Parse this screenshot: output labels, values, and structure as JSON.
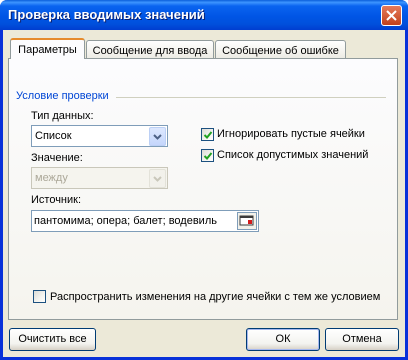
{
  "window": {
    "title": "Проверка вводимых значений"
  },
  "tabs": [
    {
      "label": "Параметры"
    },
    {
      "label": "Сообщение для ввода"
    },
    {
      "label": "Сообщение об ошибке"
    }
  ],
  "validation": {
    "group_label": "Условие проверки",
    "data_type_label": "Тип данных:",
    "data_type_value": "Список",
    "value_label": "Значение:",
    "value_value": "между",
    "source_label": "Источник:",
    "source_value": "пантомима; опера; балет; водевиль",
    "ignore_blank_label": "Игнорировать пустые ячейки",
    "ignore_blank_checked": true,
    "in_cell_dropdown_label": "Список допустимых значений",
    "in_cell_dropdown_checked": true,
    "apply_all_label": "Распространить изменения на другие ячейки с тем же условием",
    "apply_all_checked": false
  },
  "buttons": {
    "clear_all": "Очистить все",
    "ok": "ОК",
    "cancel": "Отмена"
  },
  "colors": {
    "titlebar": "#0055e5",
    "dialog_bg": "#ece9d8",
    "group_label": "#0046d5",
    "active_tab_accent": "#e68b2c"
  }
}
